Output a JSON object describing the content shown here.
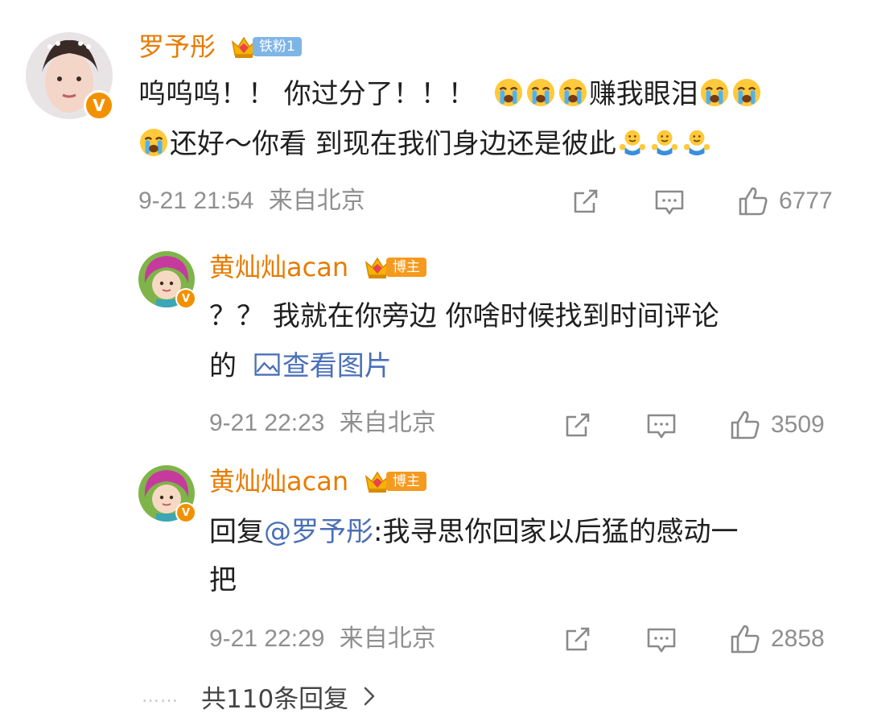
{
  "comments": [
    {
      "username": "罗予彤",
      "badge": "铁粉1",
      "text_line1_a": "呜呜呜！！ 你过分了！！！",
      "text_line1_b": "赚我眼泪",
      "text_line2_a": "还好～你看 到现在我们身边还是彼此",
      "time": "9-21 21:54",
      "location": "来自北京",
      "likes": "6777"
    },
    {
      "username": "黄灿灿acan",
      "badge": "博主",
      "text_line1": "？？ 我就在你旁边 你啥时候找到时间评论",
      "text_line2_a": "的",
      "view_image": "查看图片",
      "time": "9-21 22:23",
      "location": "来自北京",
      "likes": "3509"
    },
    {
      "username": "黄灿灿acan",
      "badge": "博主",
      "reply_prefix": "回复",
      "mention": "@罗予彤",
      "text_line1_rest": ":我寻思你回家以后猛的感动一",
      "text_line2": "把",
      "time": "9-21 22:29",
      "location": "来自北京",
      "likes": "2858"
    }
  ],
  "more_replies": {
    "dots": "……",
    "label": "共110条回复"
  },
  "icons": {
    "share": "share-icon",
    "comment": "comment-icon",
    "like": "like-icon",
    "crying": "crying-emoji",
    "hug": "hug-emoji",
    "image": "image-icon",
    "verified": "verified-v-icon",
    "crown": "crown-icon"
  },
  "colors": {
    "username": "#e77b00",
    "meta": "#8f8f8f",
    "link": "#4a6fb8",
    "fan_badge": "#7fb5e6",
    "host_badge": "#f59a1f"
  }
}
